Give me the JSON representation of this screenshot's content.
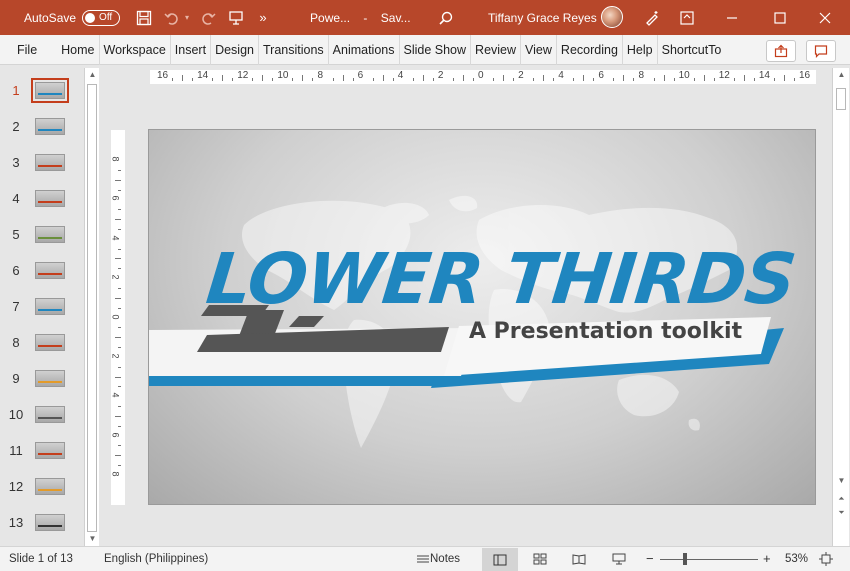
{
  "titlebar": {
    "autosave_label": "AutoSave",
    "autosave_state": "Off",
    "doc_title_1": "Powe...",
    "doc_title_sep": "-",
    "doc_title_2": "Sav...",
    "user_name": "Tiffany Grace Reyes"
  },
  "ribbon": {
    "tabs": [
      "File",
      "Home",
      "Workspace",
      "Insert",
      "Design",
      "Transitions",
      "Animations",
      "Slide Show",
      "Review",
      "View",
      "Recording",
      "Help",
      "ShortcutTo"
    ]
  },
  "thumbnails": {
    "numbers": [
      "1",
      "2",
      "3",
      "4",
      "5",
      "6",
      "7",
      "8",
      "9",
      "10",
      "11",
      "12",
      "13"
    ],
    "active_index": 1
  },
  "rulers": {
    "h_labels": [
      "16",
      "14",
      "12",
      "10",
      "8",
      "6",
      "4",
      "2",
      "0",
      "2",
      "4",
      "6",
      "8",
      "10",
      "12",
      "14",
      "16"
    ],
    "v_labels": [
      "8",
      "6",
      "4",
      "2",
      "0",
      "2",
      "4",
      "6",
      "8"
    ]
  },
  "slide": {
    "title": "LOWER THIRDS",
    "subtitle": "A Presentation toolkit"
  },
  "statusbar": {
    "slide_info": "Slide 1 of 13",
    "language": "English (Philippines)",
    "notes_label": "Notes",
    "zoom_minus": "−",
    "zoom_plus": "+",
    "zoom_level": "53%",
    "zoom_fraction": 0.53
  },
  "colors": {
    "titlebar_bg": "#b7472a",
    "accent": "#c43e1c",
    "slide_title": "#1f86bf",
    "band_blue": "#1f86bf"
  }
}
